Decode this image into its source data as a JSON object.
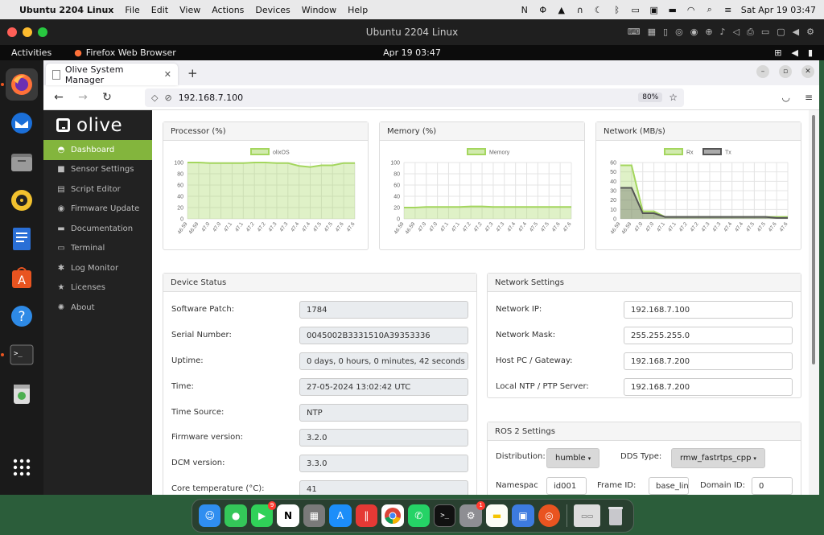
{
  "menubar": {
    "app_name": "Ubuntu 2204 Linux",
    "items": [
      "File",
      "Edit",
      "View",
      "Actions",
      "Devices",
      "Window",
      "Help"
    ],
    "clock": "Sat Apr 19  03:47"
  },
  "vm": {
    "title": "Ubuntu 2204 Linux"
  },
  "ubuntu": {
    "activities": "Activities",
    "app_label": "Firefox Web Browser",
    "clock": "Apr 19  03:47"
  },
  "browser": {
    "tab_title": "Olive System Manager",
    "url": "192.168.7.100",
    "zoom": "80%"
  },
  "sidebar": {
    "brand": "olive",
    "items": [
      {
        "label": "Dashboard",
        "icon": "dashboard-icon"
      },
      {
        "label": "Sensor Settings",
        "icon": "camera-icon"
      },
      {
        "label": "Script Editor",
        "icon": "script-icon"
      },
      {
        "label": "Firmware Update",
        "icon": "firmware-icon"
      },
      {
        "label": "Documentation",
        "icon": "folder-icon"
      },
      {
        "label": "Terminal",
        "icon": "terminal-icon"
      },
      {
        "label": "Log Monitor",
        "icon": "bug-icon"
      },
      {
        "label": "Licenses",
        "icon": "star-icon"
      },
      {
        "label": "About",
        "icon": "about-icon"
      }
    ]
  },
  "charts": {
    "processor_title": "Processor (%)",
    "memory_title": "Memory (%)",
    "network_title": "Network (MB/s)"
  },
  "chart_data": [
    {
      "type": "area",
      "title": "Processor (%)",
      "categories": [
        "46.59",
        "46.59",
        "47.0",
        "47.0",
        "47.1",
        "47.1",
        "47.2",
        "47.2",
        "47.3",
        "47.3",
        "47.4",
        "47.4",
        "47.5",
        "47.5",
        "47.6",
        "47.6"
      ],
      "series": [
        {
          "name": "olixOS",
          "values": [
            100,
            100,
            99,
            99,
            99,
            99,
            100,
            100,
            99,
            99,
            94,
            92,
            95,
            95,
            99,
            99
          ],
          "color": "#a4d65e"
        }
      ],
      "ylim": [
        0,
        100
      ],
      "yticks": [
        0,
        20,
        40,
        60,
        80,
        100
      ],
      "grid": true,
      "legend": "top"
    },
    {
      "type": "area",
      "title": "Memory (%)",
      "categories": [
        "46.59",
        "46.59",
        "47.0",
        "47.0",
        "47.1",
        "47.1",
        "47.2",
        "47.2",
        "47.3",
        "47.3",
        "47.4",
        "47.4",
        "47.5",
        "47.5",
        "47.6",
        "47.6"
      ],
      "series": [
        {
          "name": "Memory",
          "values": [
            20,
            20,
            21,
            21,
            21,
            21,
            22,
            22,
            21,
            21,
            21,
            21,
            21,
            21,
            21,
            21
          ],
          "color": "#a4d65e"
        }
      ],
      "ylim": [
        0,
        100
      ],
      "yticks": [
        0,
        20,
        40,
        60,
        80,
        100
      ],
      "grid": true,
      "legend": "top"
    },
    {
      "type": "area",
      "title": "Network (MB/s)",
      "categories": [
        "46.59",
        "46.59",
        "47.0",
        "47.0",
        "47.1",
        "47.1",
        "47.2",
        "47.2",
        "47.3",
        "47.3",
        "47.4",
        "47.4",
        "47.5",
        "47.5",
        "47.6",
        "47.6"
      ],
      "series": [
        {
          "name": "Rx",
          "values": [
            57,
            57,
            8,
            8,
            2,
            2,
            2,
            2,
            2,
            2,
            2,
            2,
            2,
            2,
            2,
            2
          ],
          "color": "#a4d65e"
        },
        {
          "name": "Tx",
          "values": [
            33,
            33,
            6,
            6,
            2,
            2,
            2,
            2,
            2,
            2,
            2,
            2,
            2,
            2,
            1,
            1
          ],
          "color": "#555555"
        }
      ],
      "ylim": [
        0,
        60
      ],
      "yticks": [
        0,
        10,
        20,
        30,
        40,
        50,
        60
      ],
      "grid": true,
      "legend": "top"
    }
  ],
  "device_status": {
    "title": "Device Status",
    "rows": [
      {
        "label": "Software Patch:",
        "value": "1784"
      },
      {
        "label": "Serial Number:",
        "value": "0045002B3331510A39353336"
      },
      {
        "label": "Uptime:",
        "value": "0 days, 0 hours, 0 minutes, 42 seconds"
      },
      {
        "label": "Time:",
        "value": "27-05-2024 13:02:42 UTC"
      },
      {
        "label": "Time Source:",
        "value": "NTP"
      },
      {
        "label": "Firmware version:",
        "value": "3.2.0"
      },
      {
        "label": "DCM version:",
        "value": "3.3.0"
      },
      {
        "label": "Core temperature (°C):",
        "value": "41"
      }
    ]
  },
  "network_settings": {
    "title": "Network Settings",
    "rows": [
      {
        "label": "Network IP:",
        "value": "192.168.7.100"
      },
      {
        "label": "Network Mask:",
        "value": "255.255.255.0"
      },
      {
        "label": "Host PC / Gateway:",
        "value": "192.168.7.200"
      },
      {
        "label": "Local NTP / PTP Server:",
        "value": "192.168.7.200"
      }
    ]
  },
  "ros2": {
    "title": "ROS 2 Settings",
    "distribution_label": "Distribution:",
    "distribution_value": "humble",
    "dds_label": "DDS Type:",
    "dds_value": "rmw_fastrtps_cpp",
    "namespace_label": "Namespac",
    "namespace_value": "id001",
    "frame_label": "Frame ID:",
    "frame_value": "base_lin",
    "domain_label": "Domain ID:",
    "domain_value": "0"
  },
  "mac_dock": {
    "facetime_badge": "9",
    "settings_badge": "1"
  }
}
